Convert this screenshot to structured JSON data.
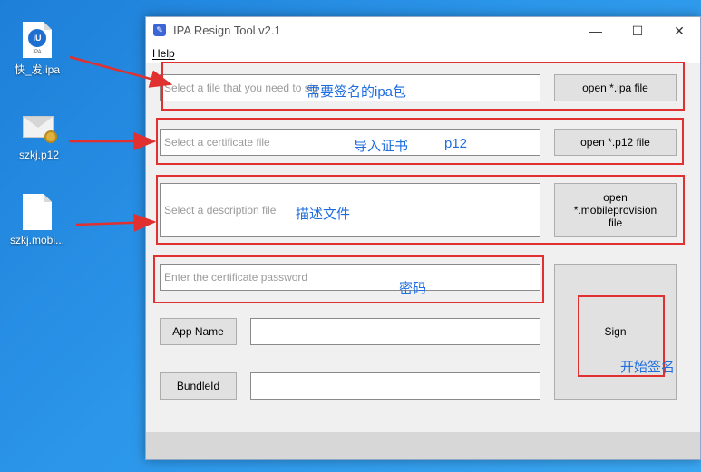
{
  "desktop": {
    "icons": [
      {
        "label": "快_发.ipa",
        "badge": "iU",
        "sub": "IPA"
      },
      {
        "label": "szkj.p12"
      },
      {
        "label": "szkj.mobi..."
      }
    ]
  },
  "window": {
    "title": "IPA Resign Tool v2.1",
    "controls": {
      "minimize": "—",
      "maximize": "☐",
      "close": "✕"
    },
    "menu": {
      "help": "Help"
    },
    "ipa_field": {
      "placeholder": "Select a file that you need to sig",
      "button": "open *.ipa file"
    },
    "cert_field": {
      "placeholder": "Select a certificate file",
      "button": "open *.p12 file"
    },
    "desc_field": {
      "placeholder": "Select a description file",
      "button": "open\n*.mobileprovision\nfile"
    },
    "password_field": {
      "placeholder": "Enter the certificate password"
    },
    "app_name": {
      "label": "App Name",
      "value": ""
    },
    "bundle_id": {
      "label": "BundleId",
      "value": ""
    },
    "sign_button": "Sign"
  },
  "annotations": {
    "ipa": "需要签名的ipa包",
    "cert": "导入证书",
    "cert_ext": "p12",
    "desc": "描述文件",
    "password": "密码",
    "sign": "开始签名"
  },
  "colors": {
    "annotation_red": "#e03030",
    "annotation_blue": "#1e6ee0"
  }
}
